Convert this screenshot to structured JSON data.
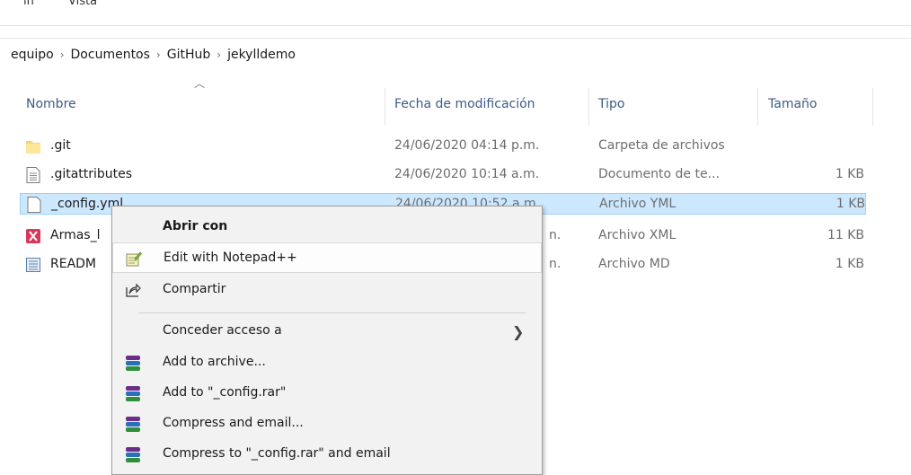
{
  "menubar": {
    "items": [
      "ín",
      "Vista"
    ]
  },
  "breadcrumb": {
    "items": [
      "equipo",
      "Documentos",
      "GitHub",
      "jekylldemo"
    ]
  },
  "columns": {
    "name": "Nombre",
    "date": "Fecha de modificación",
    "type": "Tipo",
    "size": "Tamaño"
  },
  "files": [
    {
      "name": ".git",
      "date": "24/06/2020 04:14 p.m.",
      "type": "Carpeta de archivos",
      "size": "",
      "icon": "folder-icon"
    },
    {
      "name": ".gitattributes",
      "date": "24/06/2020 10:14 a.m.",
      "type": "Documento de te...",
      "size": "1 KB",
      "icon": "text-file-icon"
    },
    {
      "name": "_config.yml",
      "date": "24/06/2020 10:52 a.m.",
      "type": "Archivo YML",
      "size": "1 KB",
      "icon": "blank-file-icon"
    },
    {
      "name": "Armas_l",
      "date": "n.",
      "type": "Archivo XML",
      "size": "11 KB",
      "icon": "xml-file-icon"
    },
    {
      "name": "READM",
      "date": "n.",
      "type": "Archivo MD",
      "size": "1 KB",
      "icon": "md-file-icon"
    }
  ],
  "context_menu": {
    "items": [
      {
        "label": "Abrir con",
        "icon": ""
      },
      {
        "label": "Edit with Notepad++",
        "icon": "notepad-plus-icon"
      },
      {
        "label": "Compartir",
        "icon": "share-icon"
      },
      {
        "label": "Conceder acceso a",
        "icon": ""
      },
      {
        "label": "Add to archive...",
        "icon": "winrar-icon"
      },
      {
        "label": "Add to \"_config.rar\"",
        "icon": "winrar-icon"
      },
      {
        "label": "Compress and email...",
        "icon": "winrar-icon"
      },
      {
        "label": "Compress to \"_config.rar\" and email",
        "icon": "winrar-icon"
      }
    ]
  },
  "colors": {
    "selection": "#cce8ff",
    "selection_border": "#99d1ff",
    "header_text": "#3e5a86"
  }
}
